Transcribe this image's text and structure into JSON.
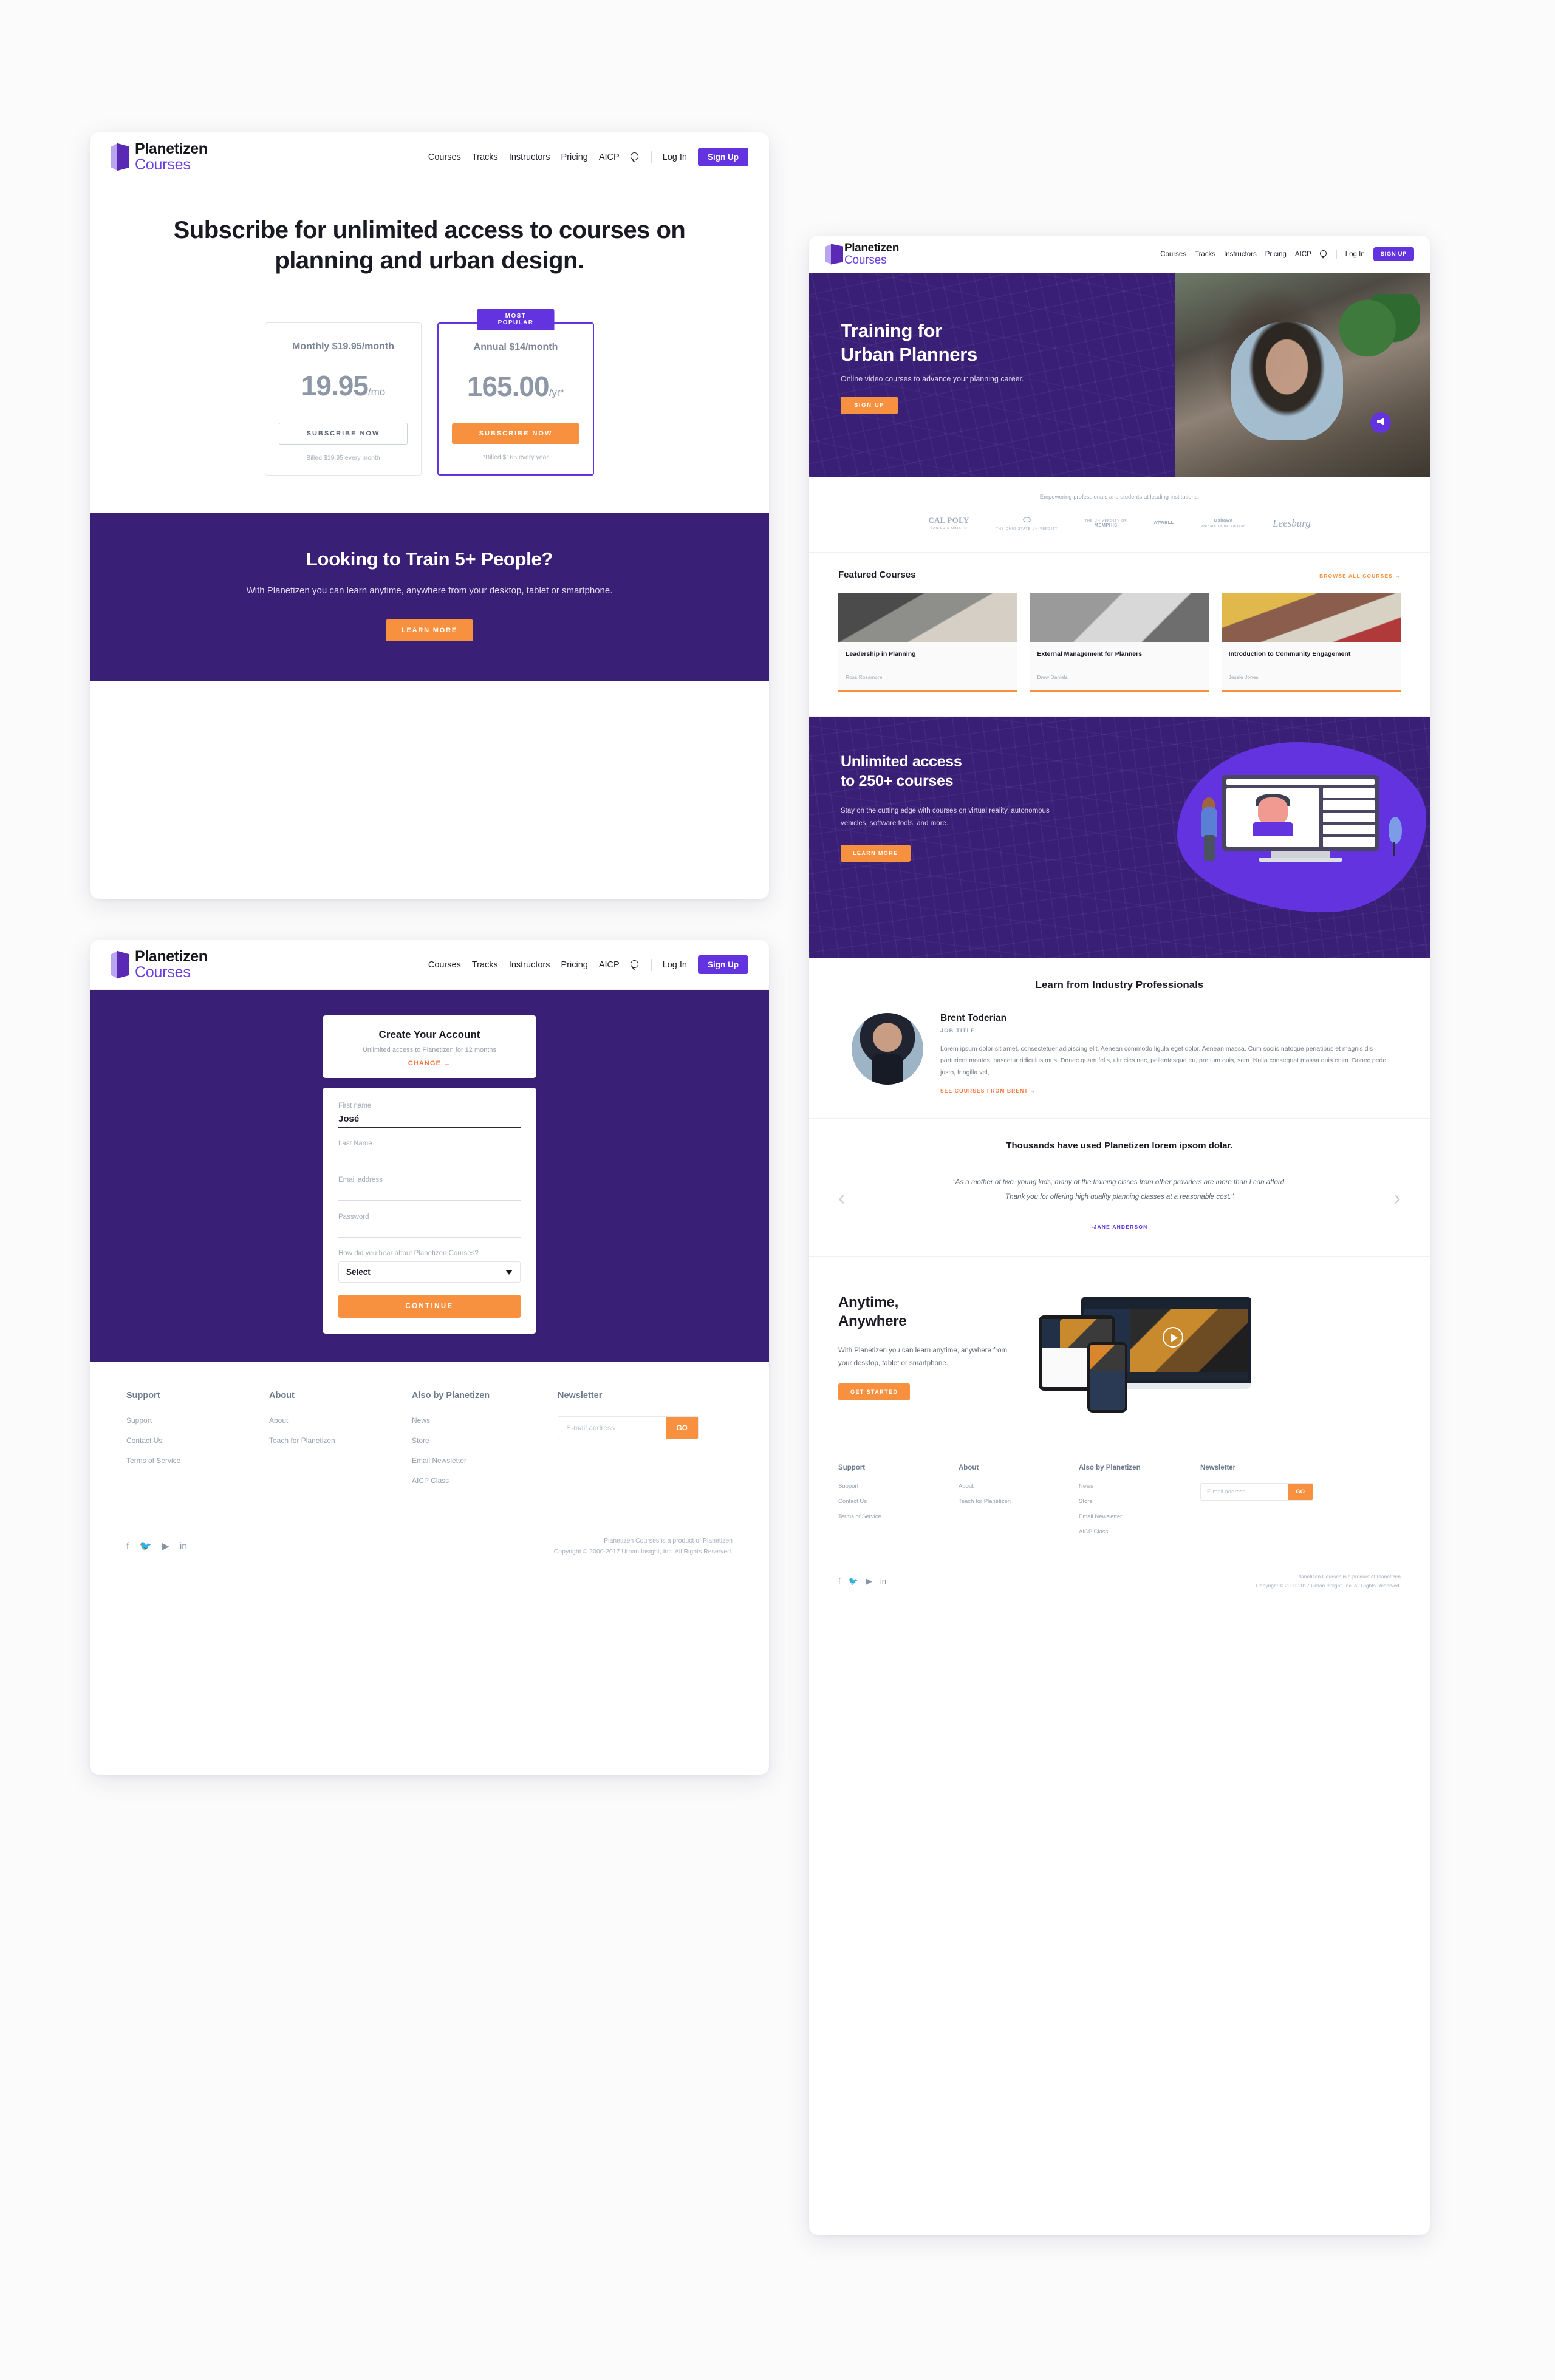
{
  "brand": {
    "name_line1": "Planetizen",
    "name_line2": "Courses",
    "accent_purple": "#6433e0",
    "deep_purple": "#3a1f77",
    "accent_orange": "#f7913f"
  },
  "nav": {
    "links": [
      "Courses",
      "Tracks",
      "Instructors",
      "Pricing",
      "AICP"
    ],
    "search_icon": "search-icon",
    "login_label": "Log In",
    "signup_label": "Sign Up",
    "signup_label_caps": "SIGN UP"
  },
  "pricing_page": {
    "title": "Subscribe for unlimited access to courses on planning and urban design.",
    "badge": "MOST POPULAR",
    "plans": [
      {
        "plan_label": "Monthly $19.95/month",
        "amount": "19.95",
        "period": "/mo",
        "cta": "SUBSCRIBE NOW",
        "note": "Billed $19.95 every month"
      },
      {
        "plan_label": "Annual $14/month",
        "amount": "165.00",
        "period": "/yr*",
        "cta": "SUBSCRIBE NOW",
        "note": "*Billed $165 every year"
      }
    ],
    "band": {
      "heading": "Looking to Train 5+ People?",
      "body": "With Planetizen you can learn anytime, anywhere from your desktop, tablet or smartphone.",
      "cta": "LEARN MORE"
    }
  },
  "signup_page": {
    "account_card": {
      "title": "Create Your Account",
      "subtitle": "Unlimited access to Planetizen for 12 months",
      "change_link": "CHANGE →"
    },
    "fields": [
      {
        "label": "First name",
        "value": "José",
        "placeholder": ""
      },
      {
        "label": "Last Name",
        "value": "",
        "placeholder": ""
      },
      {
        "label": "Email address",
        "value": "",
        "placeholder": ""
      },
      {
        "label": "Password",
        "value": "",
        "placeholder": ""
      }
    ],
    "select": {
      "label": "How did you hear about Planetizen Courses?",
      "value": "Select"
    },
    "continue_label": "CONTINUE"
  },
  "footer": {
    "columns": [
      {
        "heading": "Support",
        "links": [
          "Support",
          "Contact Us",
          "Terms of Service"
        ]
      },
      {
        "heading": "About",
        "links": [
          "About",
          "Teach for Planetizen"
        ]
      },
      {
        "heading": "Also by Planetizen",
        "links": [
          "News",
          "Store",
          "Email Newsletter",
          "AICP Class"
        ]
      }
    ],
    "newsletter": {
      "heading": "Newsletter",
      "placeholder": "E-mail address",
      "go_label": "GO"
    },
    "socials": [
      "facebook-icon",
      "twitter-icon",
      "youtube-icon",
      "linkedin-icon"
    ],
    "social_glyphs": [
      "f",
      "🐦",
      "▶",
      "in"
    ],
    "copyright_line1": "Planetizen Courses is a product of Planetizen",
    "copyright_line2": "Copyright © 2000-2017 Urban Insight, Inc. All Rights Reserved."
  },
  "home_page": {
    "hero": {
      "heading_line1": "Training for",
      "heading_line2": "Urban Planners",
      "subtitle": "Online video courses to advance your planning career.",
      "cta": "SIGN UP"
    },
    "institutions": {
      "caption": "Empowering professionals and students at leading institutions.",
      "logos": [
        {
          "name": "cal-poly-logo",
          "big": "CAL POLY",
          "small": "SAN LUIS OBISPO"
        },
        {
          "name": "ohio-state-logo",
          "big": "⬭",
          "small": "THE OHIO STATE UNIVERSITY"
        },
        {
          "name": "memphis-logo",
          "big": "MEMPHIS",
          "small": "THE UNIVERSITY OF"
        },
        {
          "name": "atwell-logo",
          "big": "ATWELL",
          "small": ""
        },
        {
          "name": "oshawa-logo",
          "big": "Oshawa",
          "small": "Prepare To Be Amazed"
        },
        {
          "name": "leesburg-logo",
          "big": "Leesburg",
          "small": ""
        }
      ]
    },
    "featured": {
      "heading": "Featured Courses",
      "browse_all": "BROWSE ALL COURSES →",
      "courses": [
        {
          "title": "Leadership in Planning",
          "author": "Ross Rossmore"
        },
        {
          "title": "External Management for Planners",
          "author": "Drew Daniels"
        },
        {
          "title": "Introduction to Community Engagement",
          "author": "Jessie Jones"
        }
      ]
    },
    "unlimited": {
      "heading_line1": "Unlimited access",
      "heading_line2": "to 250+ courses",
      "body": "Stay on the cutting edge with courses on virtual reality, autonomous vehicles, software tools, and more.",
      "cta": "LEARN MORE"
    },
    "professionals": {
      "heading": "Learn from Industry Professionals",
      "name": "Brent Toderian",
      "job_title": "JOB TITLE",
      "bio": "Lorem ipsum dolor sit amet, consectetuer adipiscing elit. Aenean commodo ligula eget dolor. Aenean massa. Cum sociis natoque penatibus et magnis dis parturient montes, nascetur ridiculus mus. Donec quam felis, ultricies nec, pellentesque eu, pretium quis, sem. Nulla consequat massa quis enim. Donec pede justo, fringilla vel,",
      "see_courses": "SEE COURSES FROM BRENT →"
    },
    "testimonial": {
      "heading": "Thousands have used Planetizen lorem ipsom dolar.",
      "quote": "\"As a mother of two, young kids, many of the  training clsses from other providers are more than I can afford. Thank you for offering high quality planning classes at a reasonable cost.\"",
      "author": "-JANE ANDERSON",
      "prev": "‹",
      "next": "›"
    },
    "anytime": {
      "heading_line1": "Anytime,",
      "heading_line2": "Anywhere",
      "body": "With Planetizen you can learn anytime, anywhere from your desktop, tablet or smartphone.",
      "cta": "GET STARTED"
    }
  }
}
